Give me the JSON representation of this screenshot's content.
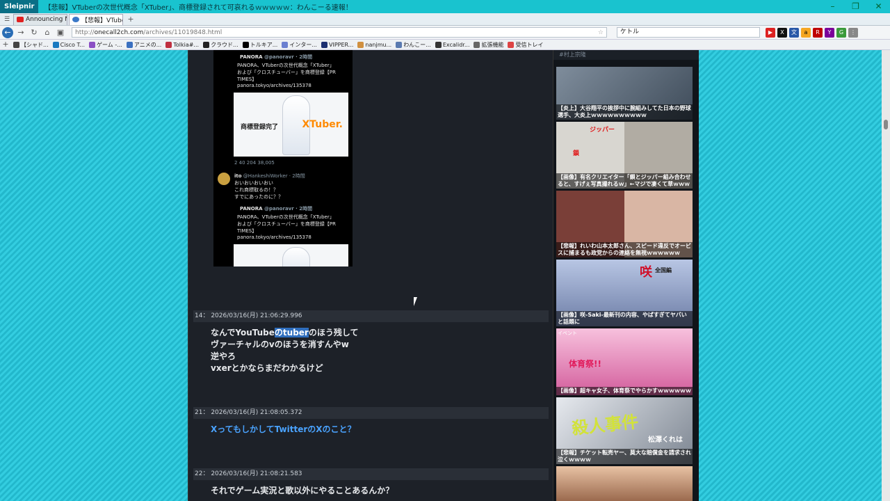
{
  "window": {
    "app_name": "Sleipnir",
    "title": "【悲報】VTuberの次世代概念「XTuber」、商標登録されて可哀れるｗｗｗｗｗ：わんこーる速報！",
    "controls": [
      "minimize",
      "restore",
      "close"
    ]
  },
  "tabs": [
    {
      "label": "Announcing N...",
      "active": false
    },
    {
      "label": "【悲報】VTuberの...",
      "active": true
    }
  ],
  "nav": {
    "url_prefix": "http://",
    "url_host": "onecall2ch.com",
    "url_path": "/archives/11019848.html",
    "search_value": "ケトル"
  },
  "bookmarks": [
    "【シャド...",
    "Cisco T...",
    "ゲーム -...",
    "アニメの...",
    "Tolkia#...",
    "クラウド...",
    "トルキア...",
    "インター...",
    "VIPPER...",
    "nanjmu...",
    "わんこー...",
    "Excalidr...",
    "拡張機能",
    "受信トレイ"
  ],
  "tweet": {
    "quote1": {
      "author": "PANORA",
      "handle": "@panoravr · 2時間",
      "lines": [
        "PANORA、VTuberの次世代概念「XTuber」",
        "および「クロスチューバー」を商標登録【PR",
        "TIMES】",
        "panora.tokyo/archives/135378"
      ]
    },
    "card_label": "商標登録完了",
    "card_brand": "XTuber.",
    "stats": "2    40    204    38,005",
    "reply": {
      "author": "ito",
      "handle": "@HankeshiWorker · 2時間",
      "lines": [
        "おいおいおいおい",
        "これ商標取るの！？",
        "すでにあったのに？？"
      ]
    },
    "quote2": {
      "author": "PANORA",
      "handle": "@panoravr · 2時間",
      "lines": [
        "PANORA、VTuberの次世代概念「XTuber」",
        "および「クロスチューバー」を商標登録【PR",
        "TIMES】",
        "panora.tokyo/archives/135378"
      ]
    }
  },
  "posts": [
    {
      "header": "14： 2026/03/16(月) 21:06:29.996",
      "line1_pre": "なんでYouTube",
      "line1_hl": "のtuber",
      "line1_post": "のほう残して",
      "lines": [
        "ヴァーチャルのvのほうを消すんやw",
        "逆やろ",
        "vxerとかならまだわかるけど"
      ]
    },
    {
      "header": "21： 2026/03/16(月) 21:08:05.372",
      "text": "XってもしかしてTwitterのXのこと？"
    },
    {
      "header": "22： 2026/03/16(月) 21:08:21.583",
      "text": "それでゲーム実況と歌以外にやることあるんか？"
    }
  ],
  "sidebar": {
    "head": "#村上宗隆",
    "items": [
      {
        "caption": "【炎上】大谷翔平の挨拶中に腕組みしてた日本の野球選手、大炎上ｗｗｗｗｗｗｗｗｗｗ",
        "color": "#6f7d8c"
      },
      {
        "caption": "【画像】有名クリエイター「鎖とジッパー組み合わせると、すげぇ写真撮れるｗ」←マジで凄くて草ｗｗｗ",
        "color": "#b9b4aa",
        "overlay_a": "ジッパー",
        "overlay_b": "鎖"
      },
      {
        "caption": "【悲報】れいわ山本太郎さん、スピード違反でオービスに捕まるも政党からの連絡を無視ｗｗｗｗｗｗ",
        "color": "#a2554a"
      },
      {
        "caption": "【画像】咲-Saki-最新刊の内容、やばすぎてヤバいと話題に",
        "color": "#9aa9c8",
        "overlay_a": "咲",
        "overlay_b": "全国編"
      },
      {
        "caption": "【画像】超キャ女子、体育祭でやらかすｗｗｗｗｗｗ",
        "color": "#e37fb6",
        "overlay_a": "イベント",
        "overlay_b": "体育祭!!"
      },
      {
        "caption": "【悲報】チケット転売ヤー、莫大な賠償金を請求され泣くｗｗｗｗ",
        "color": "#c9d230",
        "overlay_a": "殺人事件",
        "overlay_b": "松澤くれは"
      },
      {
        "caption": "",
        "color": "#cf9a7a"
      }
    ]
  }
}
